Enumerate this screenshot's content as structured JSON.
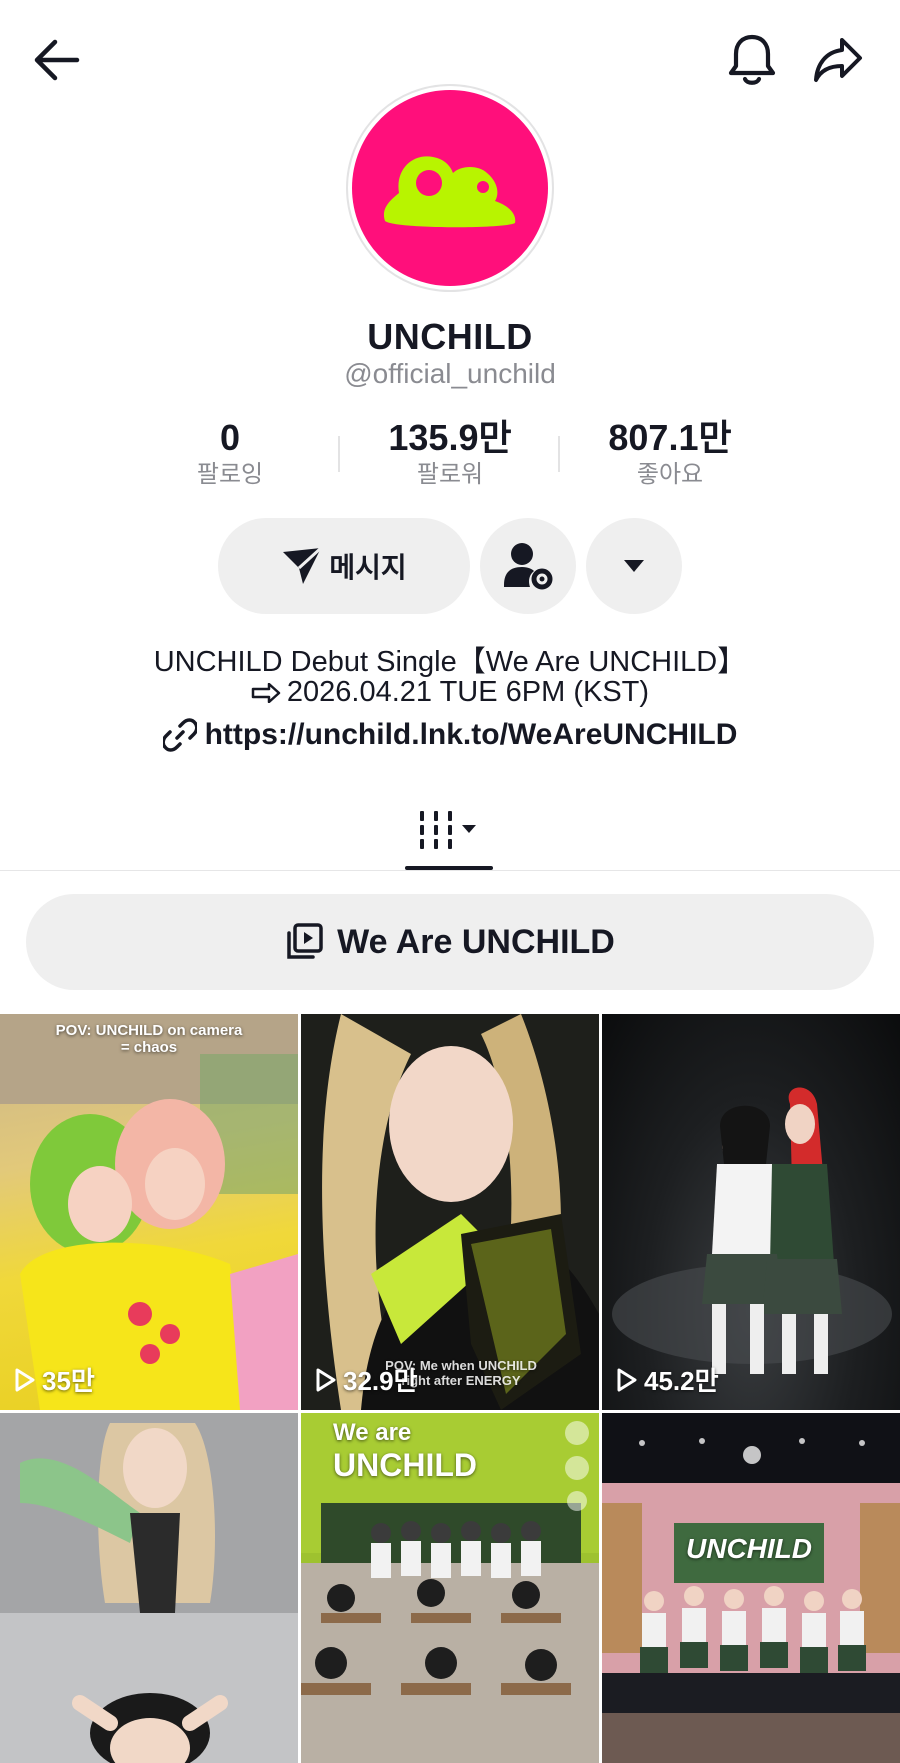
{
  "profile": {
    "name": "UNCHILD",
    "handle": "@official_unchild",
    "avatar_color": "#ff0f7b",
    "avatar_logo_color": "#b8f400"
  },
  "stats": [
    {
      "value": "0",
      "label": "팔로잉"
    },
    {
      "value": "135.9만",
      "label": "팔로워"
    },
    {
      "value": "807.1만",
      "label": "좋아요"
    }
  ],
  "actions": {
    "message_label": "메시지"
  },
  "bio": {
    "line1": "UNCHILD Debut Single【We Are UNCHILD】",
    "line2": "2026.04.21 TUE 6PM (KST)",
    "link": "https://unchild.lnk.to/WeAreUNCHILD"
  },
  "playlist": {
    "label": "We Are UNCHILD"
  },
  "videos": [
    {
      "views": "35만",
      "caption_top": "POV: UNCHILD on camera",
      "caption_top2": "= chaos",
      "bg": "yellow-pink"
    },
    {
      "views": "32.9만",
      "caption_bottom": "POV: Me when UNCHILD",
      "caption_bottom2": "right after ENERGY",
      "bg": "dark-lime"
    },
    {
      "views": "45.2만",
      "bg": "dark-stage"
    },
    {
      "bg": "grey-studio"
    },
    {
      "caption_top": "We are",
      "caption_top2": "UNCHILD",
      "bg": "classroom"
    },
    {
      "stage_text": "UNCHILD",
      "bg": "stage"
    }
  ],
  "icons": [
    "back-arrow-icon",
    "bell-icon",
    "share-icon",
    "send-icon",
    "user-settings-icon",
    "caret-down-icon",
    "link-icon",
    "grid-icon",
    "playlist-icon",
    "play-icon"
  ]
}
